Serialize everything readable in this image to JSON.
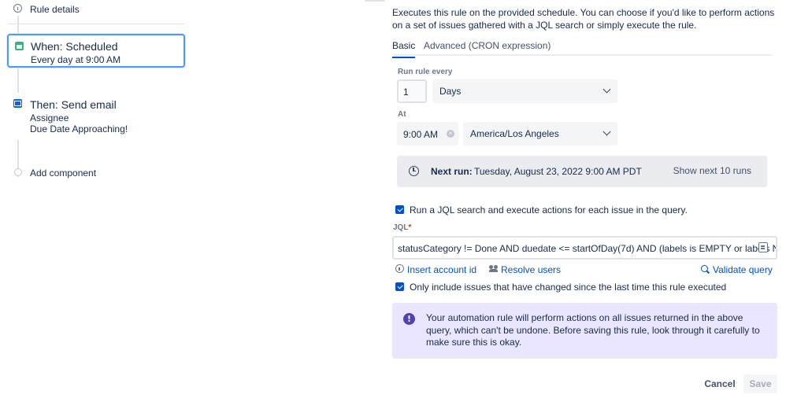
{
  "left_panel": {
    "rule_details": "Rule details",
    "trigger": {
      "title": "When: Scheduled",
      "subtitle": "Every day at 9:00 AM"
    },
    "action": {
      "title": "Then: Send email",
      "lines": [
        "Assignee",
        "Due Date Approaching!"
      ]
    },
    "add_component": "Add component"
  },
  "description": "Executes this rule on the provided schedule. You can choose if you'd like to perform actions on a set of issues gathered with a JQL search or simply execute the rule.",
  "tabs": [
    {
      "label": "Basic",
      "active": true
    },
    {
      "label": "Advanced (CRON expression)",
      "active": false
    }
  ],
  "run_every": {
    "label": "Run rule every",
    "value": "1",
    "unit": "Days"
  },
  "at": {
    "label": "At",
    "time": "9:00 AM",
    "timezone": "America/Los Angeles"
  },
  "next_run": {
    "label": "Next run:",
    "value": "Tuesday, August 23, 2022 9:00 AM PDT",
    "button": "Show next 10 runs"
  },
  "jql_option": {
    "checked": true,
    "label": "Run a JQL search and execute actions for each issue in the query."
  },
  "jql": {
    "label": "JQL",
    "required_marker": "*",
    "value": "statusCategory != Done AND duedate <= startOfDay(7d) AND (labels is EMPTY or labels NOT IN"
  },
  "jql_links": {
    "insert_account": "Insert account id",
    "resolve_users": "Resolve users",
    "validate": "Validate query"
  },
  "only_changed": {
    "checked": true,
    "label": "Only include issues that have changed since the last time this rule executed"
  },
  "warning": {
    "icon": "!",
    "text": "Your automation rule will perform actions on all issues returned in the above query, which can't be undone. Before saving this rule, look through it carefully to make sure this is okay."
  },
  "footer": {
    "cancel": "Cancel",
    "save": "Save"
  }
}
